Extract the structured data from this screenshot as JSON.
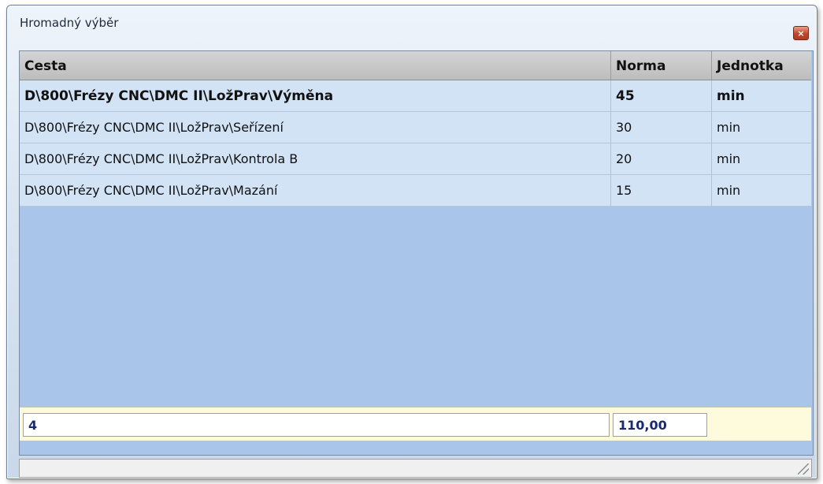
{
  "window": {
    "title": "Hromadný výběr",
    "close_glyph": "×"
  },
  "grid": {
    "columns": [
      "Cesta",
      "Norma",
      "Jednotka"
    ],
    "rows": [
      {
        "cesta": "D\\800\\Frézy CNC\\DMC II\\LožPrav\\Výměna",
        "norma": "45",
        "jednotka": "min",
        "selected": true
      },
      {
        "cesta": "D\\800\\Frézy CNC\\DMC II\\LožPrav\\Seřízení",
        "norma": "30",
        "jednotka": "min",
        "selected": false
      },
      {
        "cesta": "D\\800\\Frézy CNC\\DMC II\\LožPrav\\Kontrola B",
        "norma": "20",
        "jednotka": "min",
        "selected": false
      },
      {
        "cesta": "D\\800\\Frézy CNC\\DMC II\\LožPrav\\Mazání",
        "norma": "15",
        "jednotka": "min",
        "selected": false
      }
    ],
    "footer": {
      "count": "4",
      "sum": "110,00"
    }
  },
  "colors": {
    "grid_background": "#a9c6ea",
    "row_background": "#d3e3f6",
    "footer_background": "#fdfbdc",
    "footer_text": "#1a2a6e"
  },
  "icons": {
    "close": "close-icon",
    "resize": "resize-grip-icon"
  }
}
